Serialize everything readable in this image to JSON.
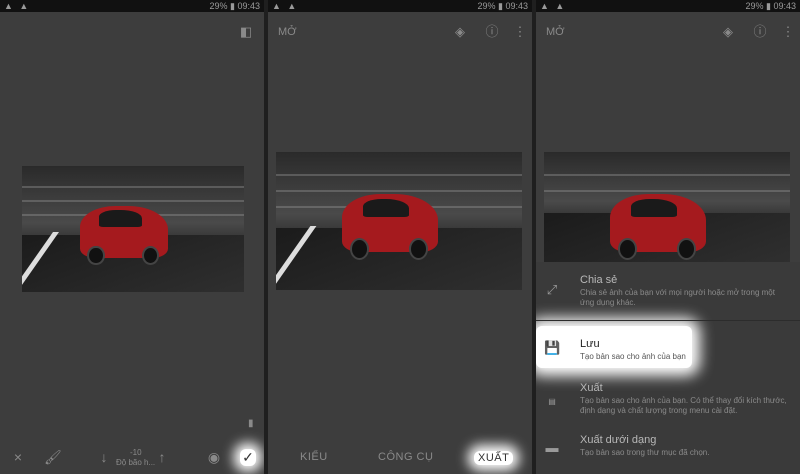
{
  "status_bar": {
    "left": "▲ ▲",
    "right": "29% ▮ 09:43"
  },
  "panel1": {
    "compare_icon": "compare-icon",
    "tools": {
      "close": "×",
      "brush": "brush-icon",
      "down": "↓",
      "value": "-10",
      "label": "Độ bão h...",
      "up": "↑",
      "eye": "eye-icon",
      "check": "✓"
    }
  },
  "panel2": {
    "title": "MỞ",
    "tabs": {
      "styles": "KIỂU",
      "tools": "CÔNG CỤ",
      "export": "XUẤT"
    }
  },
  "panel3": {
    "title": "MỞ",
    "sheet": [
      {
        "title": "Chia sẻ",
        "desc": "Chia sẻ ảnh của bạn với mọi người hoặc mở trong một ứng dụng khác.",
        "icon": "share-icon"
      },
      {
        "title": "Lưu",
        "desc": "Tạo bản sao cho ảnh của bạn",
        "icon": "save-icon"
      },
      {
        "title": "Xuất",
        "desc": "Tạo bản sao cho ảnh của bạn. Có thể thay đổi kích thước, định dạng và chất lượng trong menu cài đặt.",
        "icon": "jpg-file-icon"
      },
      {
        "title": "Xuất dưới dạng",
        "desc": "Tạo bản sao trong thư mục đã chọn.",
        "icon": "folder-icon"
      }
    ]
  }
}
